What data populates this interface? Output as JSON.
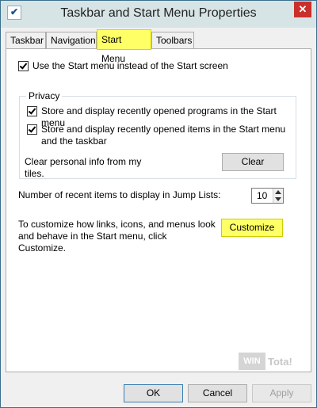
{
  "window": {
    "title": "Taskbar and Start Menu Properties",
    "close_glyph": "✕",
    "app_icon_glyph": "✔"
  },
  "tabs": [
    {
      "label": "Taskbar",
      "active": false
    },
    {
      "label": "Navigation",
      "active": false
    },
    {
      "label": "Start Menu",
      "active": true
    },
    {
      "label": "Toolbars",
      "active": false
    }
  ],
  "start_menu": {
    "use_start_menu_label": "Use the Start menu instead of the Start screen",
    "use_start_menu_checked": true,
    "privacy": {
      "legend": "Privacy",
      "store_programs_label": "Store and display recently opened programs in the Start menu",
      "store_programs_checked": true,
      "store_items_label": "Store and display recently opened items in the Start menu and the taskbar",
      "store_items_checked": true,
      "clear_info_text": "Clear personal info from my tiles.",
      "clear_button": "Clear"
    },
    "jump_lists": {
      "label": "Number of recent items to display in Jump Lists:",
      "value": "10"
    },
    "customize": {
      "text": "To customize how links, icons, and menus look and behave in the Start menu, click Customize.",
      "button": "Customize"
    },
    "watermark": {
      "box_text": "WIN",
      "text": "Tota!"
    }
  },
  "buttons": {
    "ok": "OK",
    "cancel": "Cancel",
    "apply": "Apply"
  },
  "colors": {
    "highlight": "#ffff66",
    "close": "#c9302c"
  }
}
